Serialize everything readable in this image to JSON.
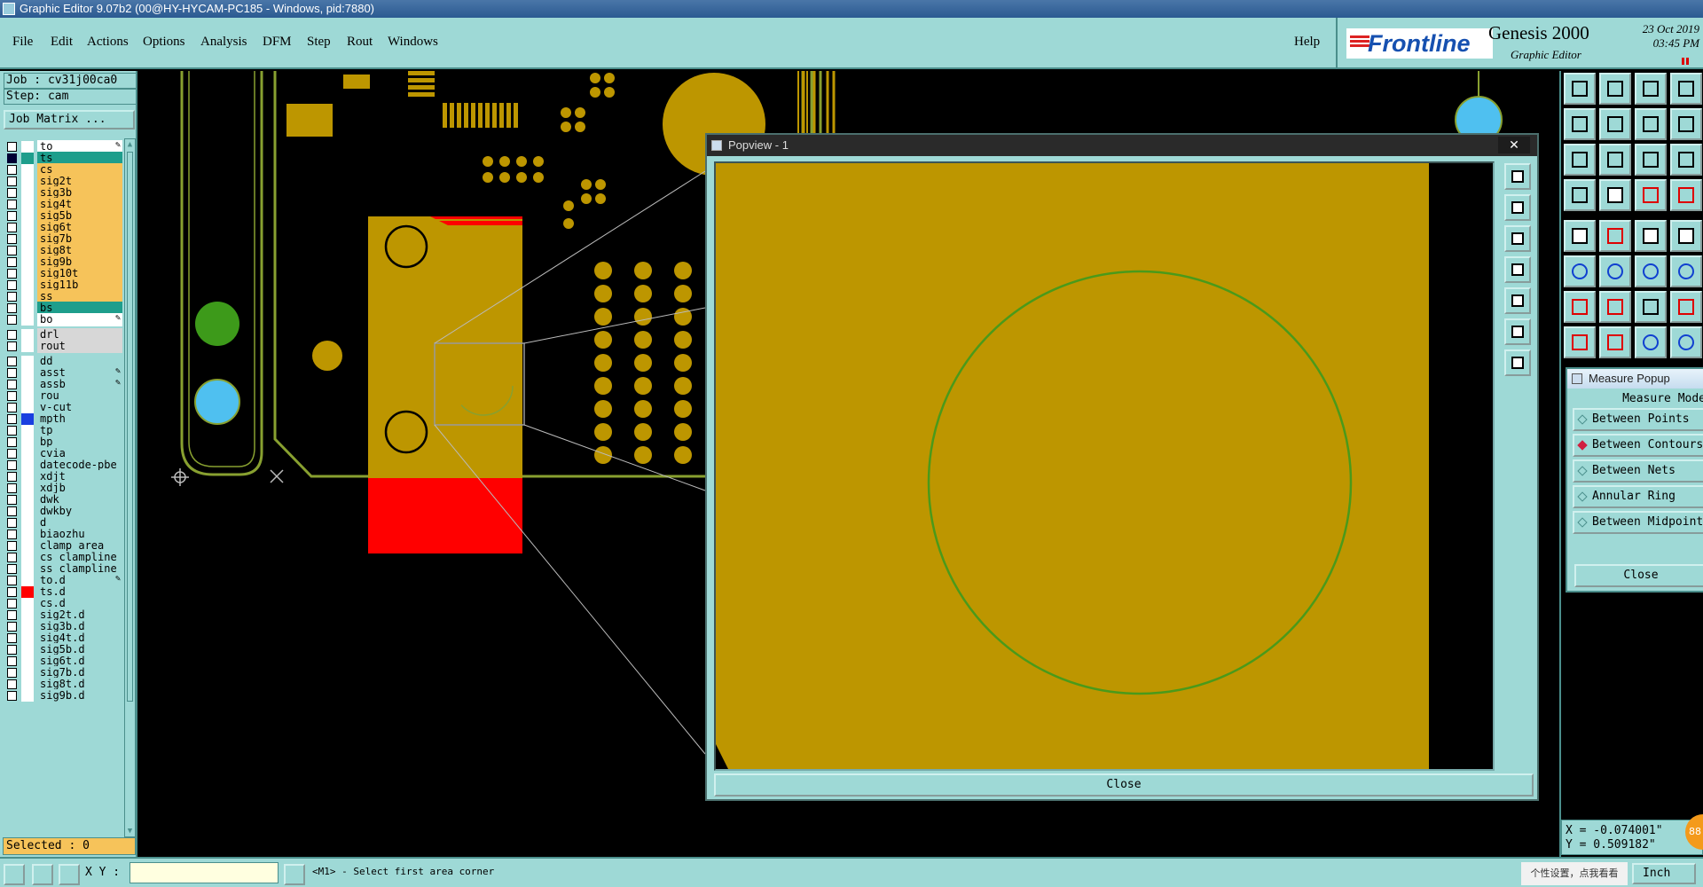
{
  "window": {
    "title": "Graphic Editor 9.07b2 (00@HY-HYCAM-PC185 - Windows, pid:7880)"
  },
  "menu": {
    "items": [
      "File",
      "Edit",
      "Actions",
      "Options",
      "Analysis",
      "DFM",
      "Step",
      "Rout",
      "Windows"
    ],
    "help": "Help"
  },
  "brand": {
    "logo": "Frontline",
    "product": "Genesis 2000",
    "subtitle": "Graphic Editor",
    "date": "23 Oct 2019",
    "time": "03:45 PM"
  },
  "job": {
    "job_line": "Job : cv31j00ca0",
    "step_line": "Step: cam",
    "job_matrix": "Job Matrix ..."
  },
  "layers": [
    {
      "name": "to",
      "color": "#ffffff",
      "swatch": "#ffffff",
      "mark": "edit"
    },
    {
      "name": "ts",
      "color": "#1e9e8c",
      "swatch": "#1e9e8c",
      "mark": "active",
      "dark": true
    },
    {
      "name": "cs",
      "color": "#f6c35a",
      "swatch": "#ffffff"
    },
    {
      "name": "sig2t",
      "color": "#f6c35a",
      "swatch": "#ffffff"
    },
    {
      "name": "sig3b",
      "color": "#f6c35a",
      "swatch": "#ffffff"
    },
    {
      "name": "sig4t",
      "color": "#f6c35a",
      "swatch": "#ffffff"
    },
    {
      "name": "sig5b",
      "color": "#f6c35a",
      "swatch": "#ffffff"
    },
    {
      "name": "sig6t",
      "color": "#f6c35a",
      "swatch": "#ffffff"
    },
    {
      "name": "sig7b",
      "color": "#f6c35a",
      "swatch": "#ffffff"
    },
    {
      "name": "sig8t",
      "color": "#f6c35a",
      "swatch": "#ffffff"
    },
    {
      "name": "sig9b",
      "color": "#f6c35a",
      "swatch": "#ffffff"
    },
    {
      "name": "sig10t",
      "color": "#f6c35a",
      "swatch": "#ffffff"
    },
    {
      "name": "sig11b",
      "color": "#f6c35a",
      "swatch": "#ffffff"
    },
    {
      "name": "ss",
      "color": "#f6c35a",
      "swatch": "#ffffff"
    },
    {
      "name": "bs",
      "color": "#1e9e8c",
      "swatch": "#ffffff"
    },
    {
      "name": "bo",
      "color": "#ffffff",
      "swatch": "#ffffff",
      "mark": "edit"
    },
    {
      "name": "",
      "gap": true
    },
    {
      "name": "drl",
      "color": "#d7d7d7",
      "swatch": "#ffffff"
    },
    {
      "name": "rout",
      "color": "#d7d7d7",
      "swatch": "#ffffff"
    },
    {
      "name": "",
      "gap": true
    },
    {
      "name": "dd",
      "color": "#9ed9d6",
      "swatch": "#ffffff"
    },
    {
      "name": "asst",
      "color": "#9ed9d6",
      "swatch": "#ffffff",
      "mark": "edit"
    },
    {
      "name": "assb",
      "color": "#9ed9d6",
      "swatch": "#ffffff",
      "mark": "edit"
    },
    {
      "name": "rou",
      "color": "#9ed9d6",
      "swatch": "#ffffff"
    },
    {
      "name": "v-cut",
      "color": "#9ed9d6",
      "swatch": "#ffffff"
    },
    {
      "name": "mpth",
      "color": "#9ed9d6",
      "swatch": "#1a3fe0"
    },
    {
      "name": "tp",
      "color": "#9ed9d6",
      "swatch": "#ffffff"
    },
    {
      "name": "bp",
      "color": "#9ed9d6",
      "swatch": "#ffffff"
    },
    {
      "name": "cvia",
      "color": "#9ed9d6",
      "swatch": "#ffffff"
    },
    {
      "name": "datecode-pbe",
      "color": "#9ed9d6",
      "swatch": "#ffffff"
    },
    {
      "name": "xdjt",
      "color": "#9ed9d6",
      "swatch": "#ffffff"
    },
    {
      "name": "xdjb",
      "color": "#9ed9d6",
      "swatch": "#ffffff"
    },
    {
      "name": "dwk",
      "color": "#9ed9d6",
      "swatch": "#ffffff"
    },
    {
      "name": "dwkby",
      "color": "#9ed9d6",
      "swatch": "#ffffff"
    },
    {
      "name": "d",
      "color": "#9ed9d6",
      "swatch": "#ffffff"
    },
    {
      "name": "biaozhu",
      "color": "#9ed9d6",
      "swatch": "#ffffff"
    },
    {
      "name": "clamp_area",
      "color": "#9ed9d6",
      "swatch": "#ffffff"
    },
    {
      "name": "cs_clampline",
      "color": "#9ed9d6",
      "swatch": "#ffffff"
    },
    {
      "name": "ss_clampline",
      "color": "#9ed9d6",
      "swatch": "#ffffff"
    },
    {
      "name": "to.d",
      "color": "#9ed9d6",
      "swatch": "#ffffff",
      "mark": "edit"
    },
    {
      "name": "ts.d",
      "color": "#9ed9d6",
      "swatch": "#ff0000"
    },
    {
      "name": "cs.d",
      "color": "#9ed9d6",
      "swatch": "#ffffff"
    },
    {
      "name": "sig2t.d",
      "color": "#9ed9d6",
      "swatch": "#ffffff"
    },
    {
      "name": "sig3b.d",
      "color": "#9ed9d6",
      "swatch": "#ffffff"
    },
    {
      "name": "sig4t.d",
      "color": "#9ed9d6",
      "swatch": "#ffffff"
    },
    {
      "name": "sig5b.d",
      "color": "#9ed9d6",
      "swatch": "#ffffff"
    },
    {
      "name": "sig6t.d",
      "color": "#9ed9d6",
      "swatch": "#ffffff"
    },
    {
      "name": "sig7b.d",
      "color": "#9ed9d6",
      "swatch": "#ffffff"
    },
    {
      "name": "sig8t.d",
      "color": "#9ed9d6",
      "swatch": "#ffffff"
    },
    {
      "name": "sig9b.d",
      "color": "#9ed9d6",
      "swatch": "#ffffff"
    }
  ],
  "selected_text": "Selected : 0",
  "popview": {
    "title": "Popview - 1",
    "close": "Close",
    "close_x": "✕"
  },
  "measure": {
    "title": "Measure Popup",
    "heading": "Measure Mode",
    "options": [
      {
        "label": "Between Points",
        "selected": false
      },
      {
        "label": "Between Contours",
        "selected": true
      },
      {
        "label": "Between Nets",
        "selected": false
      },
      {
        "label": "Annular Ring",
        "selected": false
      },
      {
        "label": "Between Midpoints",
        "selected": false
      }
    ],
    "close": "Close"
  },
  "coords": {
    "x": "X = -0.074001\"",
    "y": "Y = 0.509182\""
  },
  "status": {
    "xy_label": "X Y :",
    "xy_value": "",
    "prompt": "<M1> - Select first area corner",
    "units": "Inch",
    "tray_text": "个性设置，点我看看",
    "badge": "88"
  },
  "colors": {
    "panel": "#9ed9d6",
    "panel_border": "#4b8f8c",
    "copper": "#bd9600",
    "trace": "#88a030",
    "active_layer": "#1e9e8c",
    "signal_layer": "#f6c35a",
    "red_pad": "#ff0000",
    "green_pad": "#3d9a1a",
    "blue_pad": "#4fc0f0"
  }
}
